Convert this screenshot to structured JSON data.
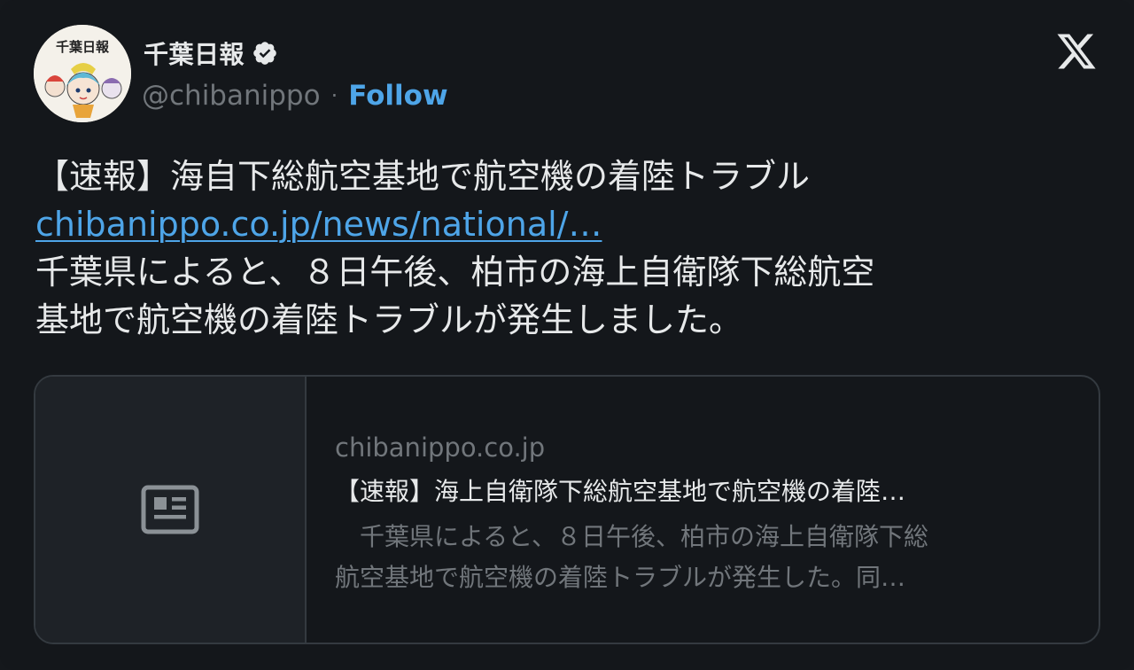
{
  "author": {
    "display_name": "千葉日報",
    "handle": "@chibanippo",
    "separator": "·",
    "follow_label": "Follow",
    "avatar_text": "千葉日報"
  },
  "tweet": {
    "line1": "【速報】海自下総航空基地で航空機の着陸トラブル",
    "link": "chibanippo.co.jp/news/national/…",
    "line3": "千葉県によると、８日午後、柏市の海上自衛隊下総航空",
    "line4": "基地で航空機の着陸トラブルが発生しました。"
  },
  "link_card": {
    "domain": "chibanippo.co.jp",
    "title": "【速報】海上自衛隊下総航空基地で航空機の着陸…",
    "desc_line1": "　千葉県によると、８日午後、柏市の海上自衛隊下総",
    "desc_line2": "航空基地で航空機の着陸トラブルが発生した。同…",
    "thumb_icon": "news-article-icon"
  },
  "colors": {
    "background": "#14171b",
    "link": "#4ea5e8",
    "muted": "#71767b",
    "text": "#e7e9ea"
  }
}
